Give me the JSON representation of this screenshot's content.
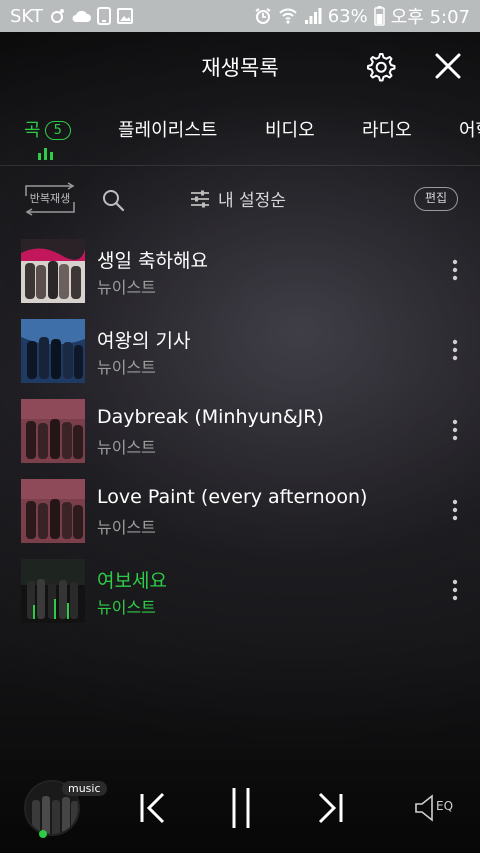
{
  "status_bar": {
    "carrier": "SKT",
    "battery": "63%",
    "time": "오후 5:07"
  },
  "header": {
    "title": "재생목록"
  },
  "tabs": [
    {
      "label": "곡",
      "count": "5"
    },
    {
      "label": "플레이리스트"
    },
    {
      "label": "비디오"
    },
    {
      "label": "라디오"
    },
    {
      "label": "어학"
    }
  ],
  "toolbar": {
    "repeat_label": "반복재생",
    "sort_label": "내 설정순",
    "edit_label": "편집"
  },
  "songs": [
    {
      "title": "생일 축하해요",
      "artist": "뉴이스트"
    },
    {
      "title": "여왕의 기사",
      "artist": "뉴이스트"
    },
    {
      "title": "Daybreak (Minhyun&JR)",
      "artist": "뉴이스트"
    },
    {
      "title": "Love Paint (every afternoon)",
      "artist": "뉴이스트"
    },
    {
      "title": "여보세요",
      "artist": "뉴이스트",
      "playing": true
    }
  ],
  "player": {
    "tag": "music",
    "eq_label": "EQ"
  },
  "colors": {
    "accent": "#2ecc46",
    "statusbar": "#b9bcbd"
  }
}
